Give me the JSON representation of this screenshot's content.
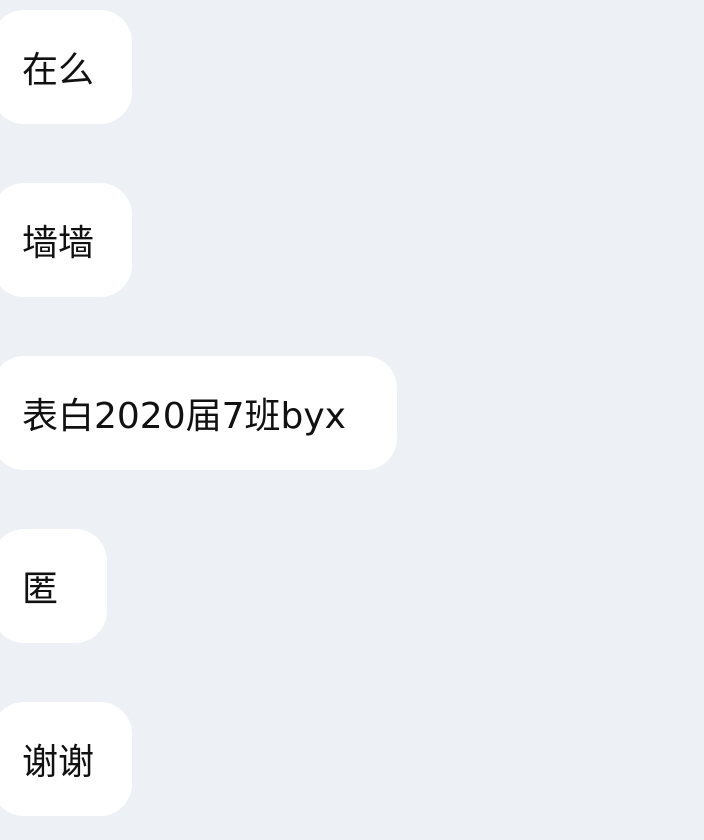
{
  "messages": [
    {
      "text": "在么"
    },
    {
      "text": "墙墙"
    },
    {
      "text": "表白2020届7班byx"
    },
    {
      "text": "匿"
    },
    {
      "text": "谢谢"
    }
  ]
}
